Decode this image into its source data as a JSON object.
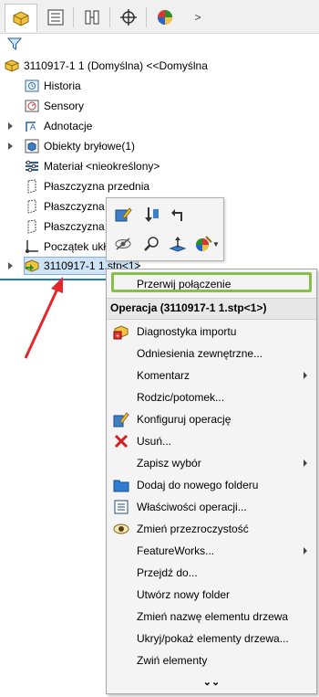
{
  "tree": {
    "root_label": "3110917-1 1 (Domyślna) <<Domyślna",
    "items": [
      {
        "label": "Historia"
      },
      {
        "label": "Sensory"
      },
      {
        "label": "Adnotacje"
      },
      {
        "label": "Obiekty bryłowe(1)"
      },
      {
        "label": "Materiał <nieokreślony>"
      },
      {
        "label": "Płaszczyzna przednia"
      },
      {
        "label": "Płaszczyzna"
      },
      {
        "label": "Płaszczyzna"
      },
      {
        "label": "Początek ukł"
      },
      {
        "label": "3110917-1 1.stp<1>"
      }
    ]
  },
  "context_menu": {
    "top_item": "Przerwij połączenie",
    "header": "Operacja (3110917-1 1.stp<1>)",
    "items": [
      {
        "label": "Diagnostyka importu",
        "icon": "import-diagnostics-icon"
      },
      {
        "label": "Odniesienia zewnętrzne...",
        "icon": ""
      },
      {
        "label": "Komentarz",
        "icon": "",
        "submenu": true
      },
      {
        "label": "Rodzic/potomek...",
        "icon": ""
      },
      {
        "label": "Konfiguruj operację",
        "icon": "configure-icon"
      },
      {
        "label": "Usuń...",
        "icon": "delete-icon"
      },
      {
        "label": "Zapisz wybór",
        "icon": "",
        "submenu": true
      },
      {
        "label": "Dodaj do nowego folderu",
        "icon": "folder-icon"
      },
      {
        "label": "Właściwości operacji...",
        "icon": "properties-icon"
      },
      {
        "label": "Zmień przezroczystość",
        "icon": "transparency-icon"
      },
      {
        "label": "FeatureWorks...",
        "icon": "",
        "submenu": true
      },
      {
        "label": "Przejdź do...",
        "icon": ""
      },
      {
        "label": "Utwórz nowy folder",
        "icon": ""
      },
      {
        "label": "Zmień nazwę elementu drzewa",
        "icon": ""
      },
      {
        "label": "Ukryj/pokaż elementy drzewa...",
        "icon": ""
      },
      {
        "label": "Zwiń elementy",
        "icon": ""
      }
    ],
    "expand_glyph": "⌄⌄"
  },
  "colors": {
    "accent": "#1f7ac6",
    "highlight_green": "#86c04a",
    "annotation_red": "#e5262b"
  }
}
